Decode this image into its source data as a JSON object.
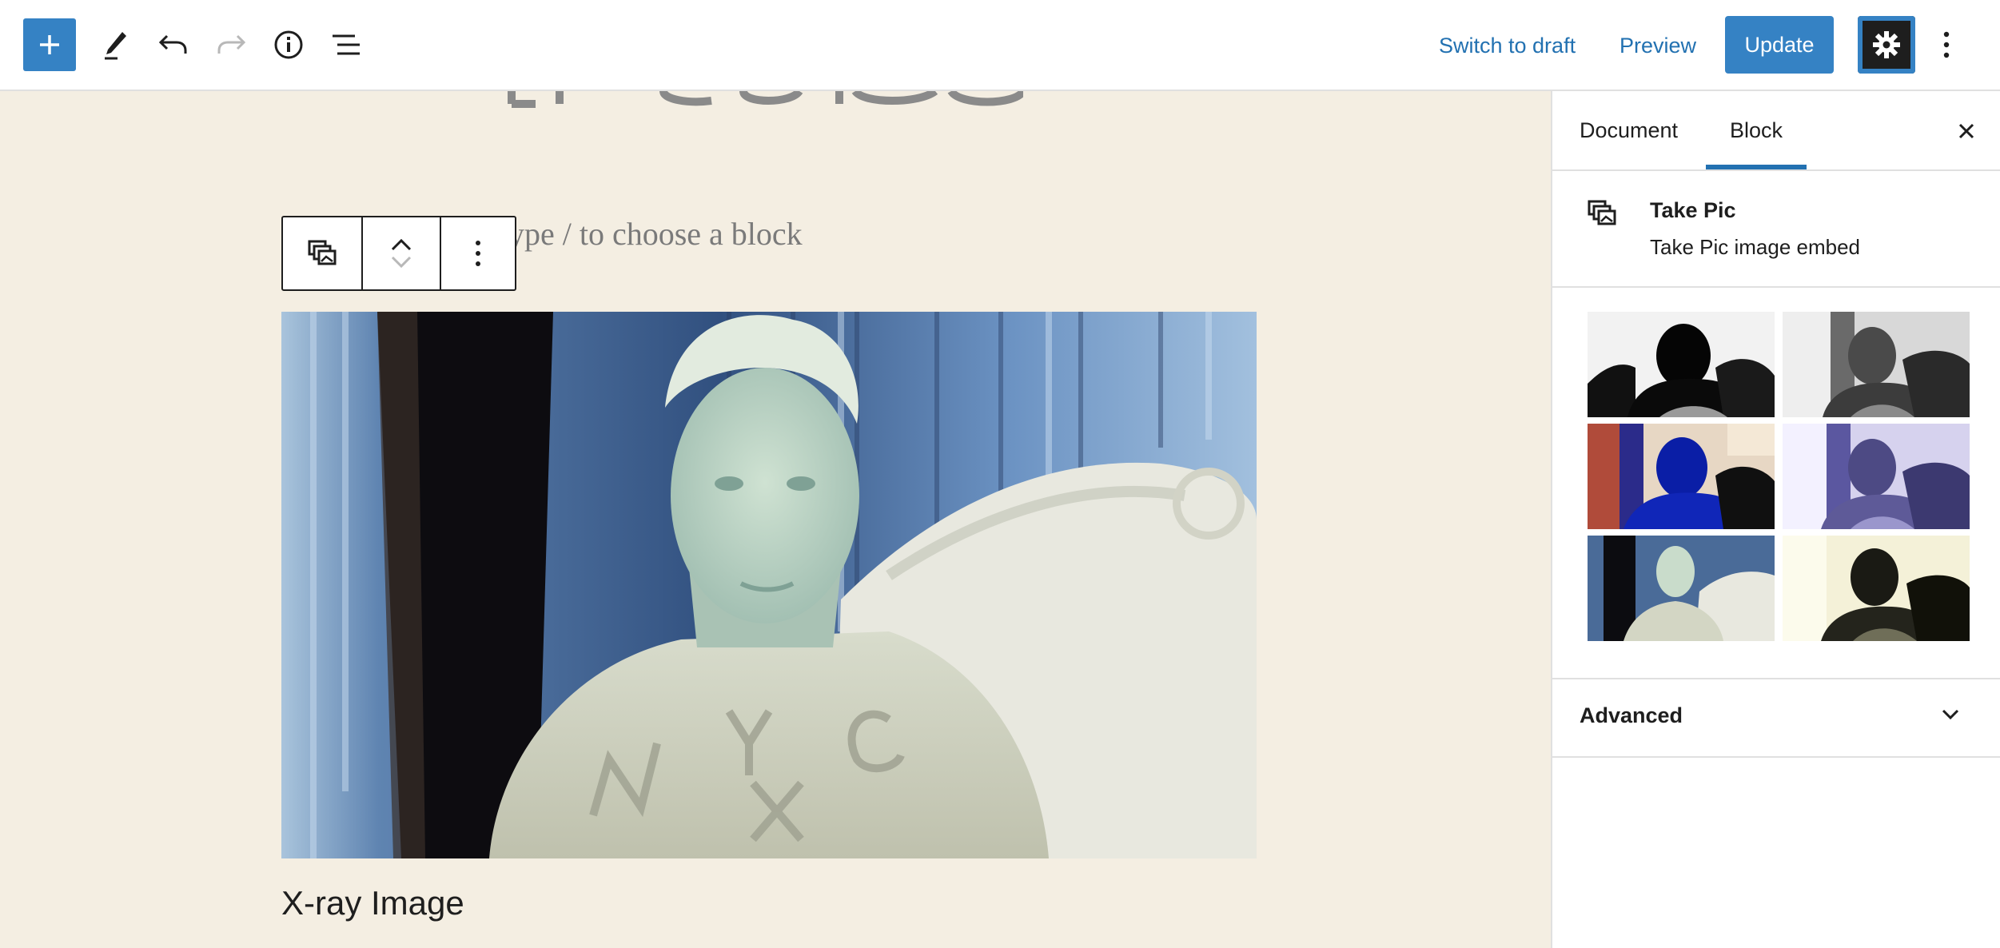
{
  "toolbar": {
    "add_icon": "plus-icon",
    "tools_icon": "pencil-icon",
    "undo_icon": "undo-icon",
    "redo_icon": "redo-icon",
    "info_icon": "info-icon",
    "outline_icon": "list-view-icon",
    "switch_to_draft": "Switch to draft",
    "preview": "Preview",
    "update": "Update",
    "settings_icon": "gear-icon",
    "more_icon": "more-vertical-icon"
  },
  "editor": {
    "placeholder": "ype / to choose a block",
    "caption": "X-ray Image"
  },
  "sidebar": {
    "tabs": [
      "Document",
      "Block"
    ],
    "active_tab": "Block",
    "block_name": "Take Pic",
    "block_description": "Take Pic image embed",
    "thumbnails": [
      "black-and-white",
      "grayscale",
      "blue-tint",
      "lavender-tint",
      "x-ray",
      "sepia-dark"
    ],
    "advanced_label": "Advanced"
  },
  "colors": {
    "accent": "#3582c4",
    "canvas_bg": "#f4eee2",
    "link": "#2271b1"
  }
}
